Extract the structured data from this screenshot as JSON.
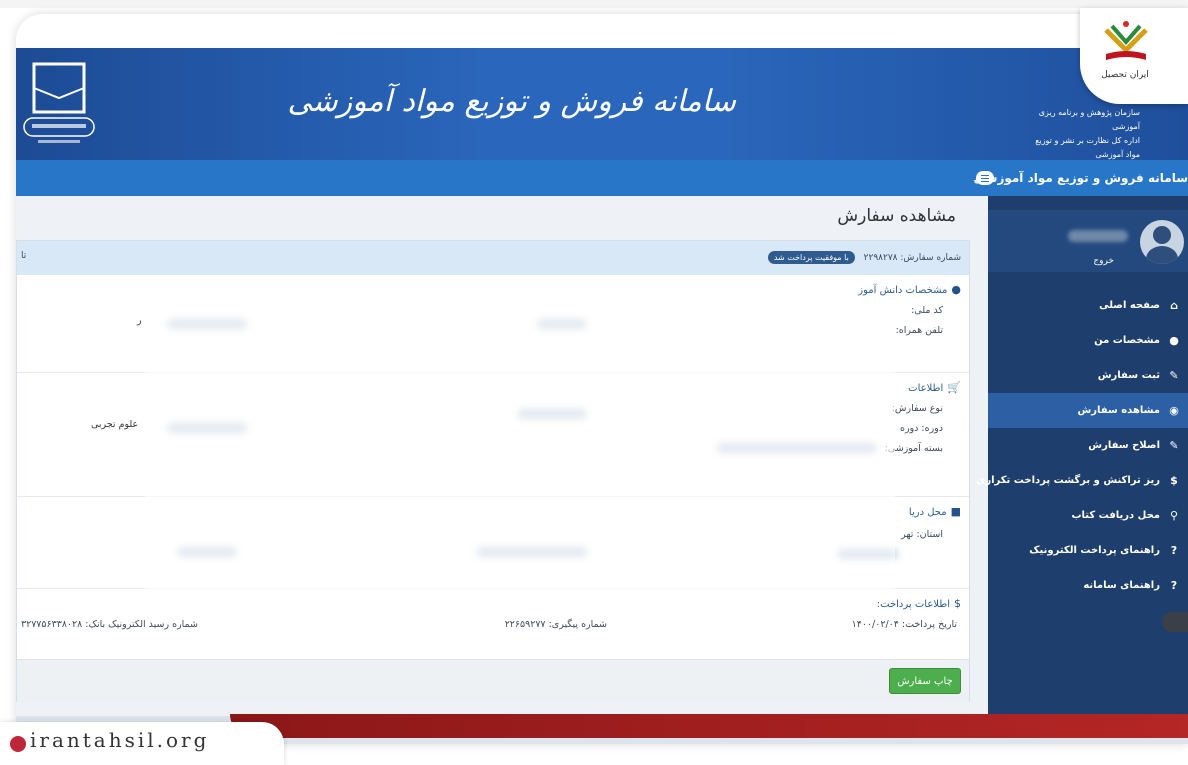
{
  "brand": {
    "name": "ایران تحصیل"
  },
  "header": {
    "site_title": "سامانه فروش و توزیع مواد آموزشی",
    "org_line_1": "سازمان پژوهش و برنامه ریزی آموزشی",
    "org_line_2": "اداره کل نظارت بر نشر و توزیع مواد آموزشی"
  },
  "navbar": {
    "title": "سامانه فروش و توزیع مواد آموزشی"
  },
  "sidebar": {
    "logout_label": "خروج",
    "items": [
      {
        "label": "صفحه اصلی",
        "icon": "home-icon",
        "glyph": "⌂"
      },
      {
        "label": "مشخصات من",
        "icon": "user-icon",
        "glyph": "●"
      },
      {
        "label": "ثبت سفارش",
        "icon": "edit-icon",
        "glyph": "✎"
      },
      {
        "label": "مشاهده سفارش",
        "icon": "eye-icon",
        "glyph": "◉"
      },
      {
        "label": "اصلاح سفارش",
        "icon": "edit-icon",
        "glyph": "✎"
      },
      {
        "label": "ریز تراکنش و برگشت پرداخت تکراری",
        "icon": "dollar-icon",
        "glyph": "$"
      },
      {
        "label": "محل دریافت کتاب",
        "icon": "location-icon",
        "glyph": "⚲"
      },
      {
        "label": "راهنمای پرداخت الکترونیک",
        "icon": "help-icon",
        "glyph": "?"
      },
      {
        "label": "راهنمای سامانه",
        "icon": "help-icon",
        "glyph": "?"
      }
    ],
    "active_index": 3
  },
  "main": {
    "page_title": "مشاهده سفارش",
    "order_number_label": "شماره سفارش:",
    "order_number": "۲۲۹۸۲۷۸",
    "status_badge": "با موفقیت پرداخت شد",
    "header_left_fragment": "تا",
    "sections": {
      "student": {
        "title": "مشخصات دانش آموز",
        "icon": "user-icon",
        "fields": [
          "کد ملی:",
          "تلفن همراه:"
        ],
        "left_fragment": "ر"
      },
      "order": {
        "title": "اطلاعات",
        "icon": "cart-icon",
        "fields": [
          "نوع سفارش:",
          "دوره: دوره",
          "بسته آموزشی:"
        ],
        "left_value": "علوم تجربی"
      },
      "delivery": {
        "title": "محل دریا",
        "icon": "book-icon",
        "fields": [
          "استان: تهر"
        ]
      },
      "payment": {
        "title": "اطلاعات پرداخت:",
        "icon": "dollar-icon",
        "date_label": "تاریخ پرداخت:",
        "date_value": "۱۴۰۰/۰۲/۰۴",
        "tracking_label": "شماره پیگیری:",
        "tracking_value": "۲۲۶۵۹۲۷۷",
        "receipt_label": "شماره رسید الکترونیک بانک:",
        "receipt_value": "۳۲۷۷۵۶۳۳۸۰۲۸"
      }
    },
    "print_button": "چاپ سفارش"
  },
  "watermark": {
    "text": "irantahsil.org"
  }
}
